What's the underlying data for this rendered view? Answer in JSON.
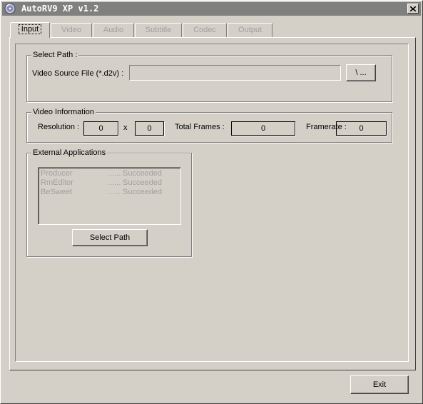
{
  "window": {
    "title": "AutoRV9  XP  v1.2",
    "close_symbol": "×",
    "icon": "app-disc-icon"
  },
  "tabs": [
    {
      "label": "Input",
      "active": true
    },
    {
      "label": "Video",
      "active": false
    },
    {
      "label": "Audio",
      "active": false
    },
    {
      "label": "Subtitle",
      "active": false
    },
    {
      "label": "Codec",
      "active": false
    },
    {
      "label": "Output",
      "active": false
    }
  ],
  "select_path": {
    "legend": "Select Path :",
    "source_label": "Video Source File (*.d2v) :",
    "source_value": "",
    "browse_label": "\\ ..."
  },
  "video_info": {
    "legend": "Video Information",
    "resolution_label": "Resolution :",
    "width": "0",
    "separator": "x",
    "height": "0",
    "total_frames_label": "Total Frames :",
    "total_frames": "0",
    "framerate_label": "Framerate :",
    "framerate": "0"
  },
  "external_apps": {
    "legend": "External Applications",
    "items": [
      {
        "name": "Producer",
        "dots": "......",
        "status": "Succeeded"
      },
      {
        "name": "RmEditor",
        "dots": "......",
        "status": "Succeeded"
      },
      {
        "name": "BeSweet",
        "dots": "......",
        "status": "Succeeded"
      }
    ],
    "button_label": "Select Path"
  },
  "footer": {
    "exit_label": "Exit"
  },
  "colors": {
    "face": "#d4d0c8",
    "titlebar_inactive": "#808080",
    "disabled_text": "#a0a0a0"
  }
}
